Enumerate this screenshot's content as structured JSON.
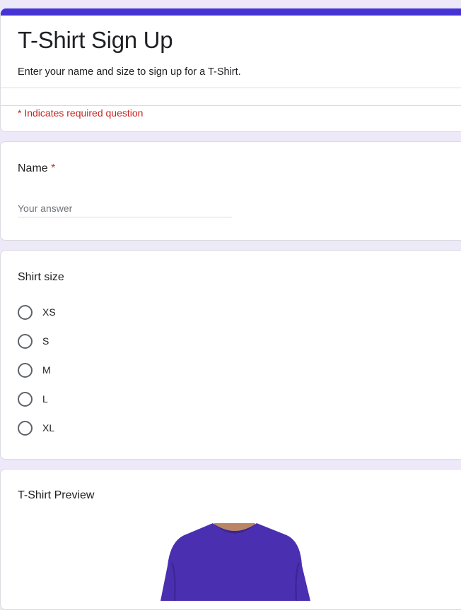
{
  "form": {
    "title": "T-Shirt Sign Up",
    "description": "Enter your name and size to sign up for a T-Shirt.",
    "required_note": "* Indicates required question",
    "accent_color": "#4533d4"
  },
  "name_question": {
    "label": "Name",
    "required_marker": "*",
    "placeholder": "Your answer"
  },
  "size_question": {
    "label": "Shirt size",
    "options": [
      "XS",
      "S",
      "M",
      "L",
      "XL"
    ]
  },
  "preview": {
    "label": "T-Shirt Preview",
    "shirt_color": "#4a2fb0"
  }
}
